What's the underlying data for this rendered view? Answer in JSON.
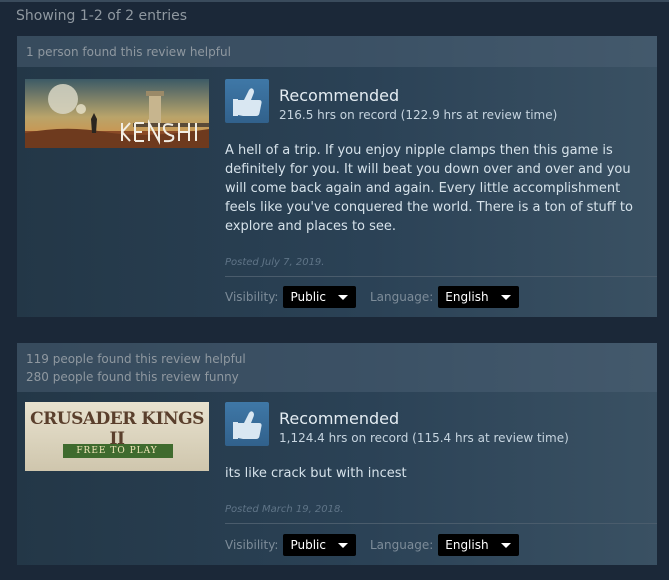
{
  "header": {
    "showing_text": "Showing 1-2 of 2 entries"
  },
  "reviews": [
    {
      "helpful": [
        "1 person found this review helpful"
      ],
      "game_logo_text": "KENSHI",
      "recommendation": "Recommended",
      "hours": "216.5 hrs on record (122.9 hrs at review time)",
      "body": "A hell of a trip. If you enjoy nipple clamps then this game is definitely for you. It will beat you down over and over and you will come back again and again. Every little accomplishment feels like you've conquered the world. There is a ton of stuff to explore and places to see.",
      "posted": "Posted July 7, 2019.",
      "visibility_label": "Visibility:",
      "visibility_value": "Public",
      "language_label": "Language:",
      "language_value": "English"
    },
    {
      "helpful": [
        "119 people found this review helpful",
        "280 people found this review funny"
      ],
      "game_logo_text": "CRUSADER KINGS II",
      "game_logo_sub": "FREE TO PLAY",
      "recommendation": "Recommended",
      "hours": "1,124.4 hrs on record (115.4 hrs at review time)",
      "body": "its like crack but with incest",
      "posted": "Posted March 19, 2018.",
      "visibility_label": "Visibility:",
      "visibility_value": "Public",
      "language_label": "Language:",
      "language_value": "English"
    }
  ],
  "icons": {
    "recommend": "thumbs-up-icon",
    "dropdown": "caret-down-icon"
  },
  "colors": {
    "background": "#1b2838",
    "accent": "#3f78a7",
    "select_bg": "#000000"
  }
}
